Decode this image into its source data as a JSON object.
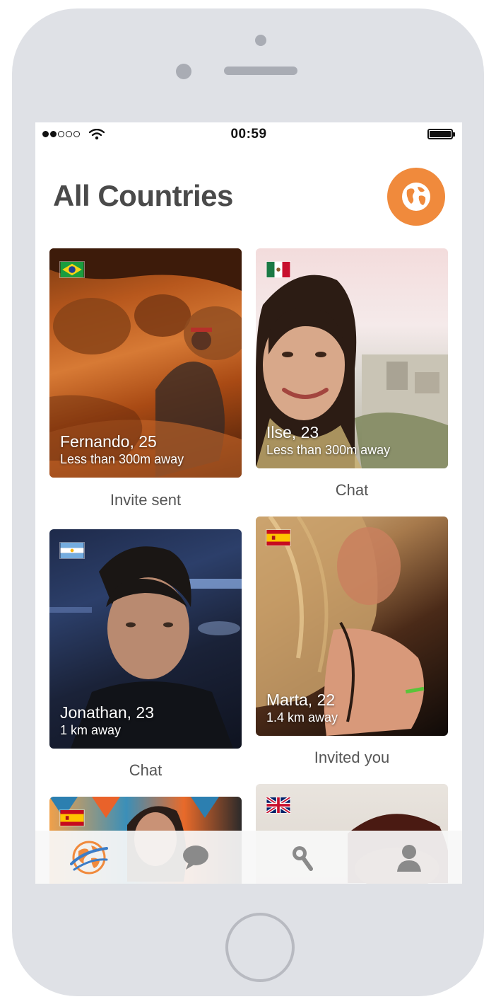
{
  "status_bar": {
    "time": "00:59",
    "signal_bars": 2,
    "signal_total": 5
  },
  "header": {
    "title": "All Countries",
    "globe_icon": "globe-icon"
  },
  "colors": {
    "accent": "#f08a3c",
    "title": "#4a4a4a",
    "status_text": "#555555"
  },
  "cards": [
    {
      "name": "Fernando, 25",
      "distance": "Less than 300m away",
      "status": "Invite sent",
      "flag": "brazil-flag-icon"
    },
    {
      "name": "Ilse, 23",
      "distance": "Less than 300m away",
      "status": "Chat",
      "flag": "mexico-flag-icon"
    },
    {
      "name": "Jonathan, 23",
      "distance": "1 km away",
      "status": "Chat",
      "flag": "argentina-flag-icon"
    },
    {
      "name": "Marta, 22",
      "distance": "1.4 km away",
      "status": "Invited you",
      "flag": "spain-flag-icon"
    },
    {
      "flag": "spain-flag-icon"
    },
    {
      "flag": "uk-flag-icon"
    }
  ],
  "tabbar": {
    "tabs": [
      {
        "icon": "globe-icon",
        "active": true
      },
      {
        "icon": "chat-bubble-icon",
        "active": false
      },
      {
        "icon": "search-icon",
        "active": false
      },
      {
        "icon": "profile-icon",
        "active": false
      }
    ]
  }
}
